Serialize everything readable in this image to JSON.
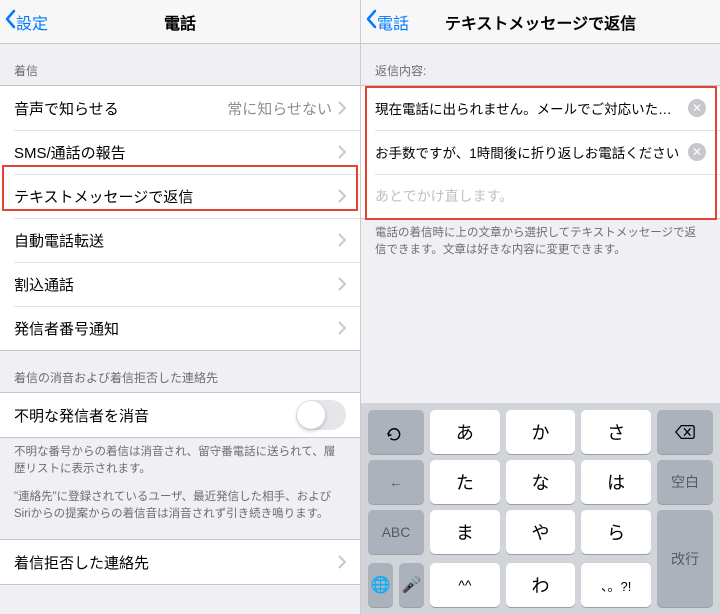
{
  "left": {
    "back": "設定",
    "title": "電話",
    "section_incoming": "着信",
    "rows": {
      "voice": {
        "label": "音声で知らせる",
        "detail": "常に知らせない"
      },
      "sms": {
        "label": "SMS/通話の報告"
      },
      "respond_text": {
        "label": "テキストメッセージで返信"
      },
      "forward": {
        "label": "自動電話転送"
      },
      "waiting": {
        "label": "割込通話"
      },
      "callerid": {
        "label": "発信者番号通知"
      }
    },
    "section_silence": "着信の消音および着信拒否した連絡先",
    "silence_unknown": {
      "label": "不明な発信者を消音"
    },
    "foot1": "不明な番号からの着信は消音され、留守番電話に送られて、履歴リストに表示されます。",
    "foot2": "\"連絡先\"に登録されているユーザ、最近発信した相手、およびSiriからの提案からの着信音は消音されず引き続き鳴ります。",
    "blocked": {
      "label": "着信拒否した連絡先"
    }
  },
  "right": {
    "back": "電話",
    "title": "テキストメッセージで返信",
    "section": "返信内容:",
    "replies": [
      "現在電話に出られません。メールでご対応いたしま…",
      "お手数ですが、1時間後に折り返しお電話ください。"
    ],
    "placeholder": "あとでかけ直します。",
    "footer": "電話の着信時に上の文章から選択してテキストメッセージで返信できます。文章は好きな内容に変更できます。"
  },
  "keyboard": {
    "rows": [
      [
        "あ",
        "か",
        "さ"
      ],
      [
        "た",
        "な",
        "は"
      ],
      [
        "ま",
        "や",
        "ら"
      ],
      [
        "^^",
        "わ",
        "、。?!"
      ]
    ],
    "left_keys": [
      "→",
      "←",
      "ABC"
    ],
    "right_keys": [
      "空白",
      "改行"
    ],
    "globe": "🌐",
    "mic": "🎤",
    "smiley": "☺︎"
  }
}
